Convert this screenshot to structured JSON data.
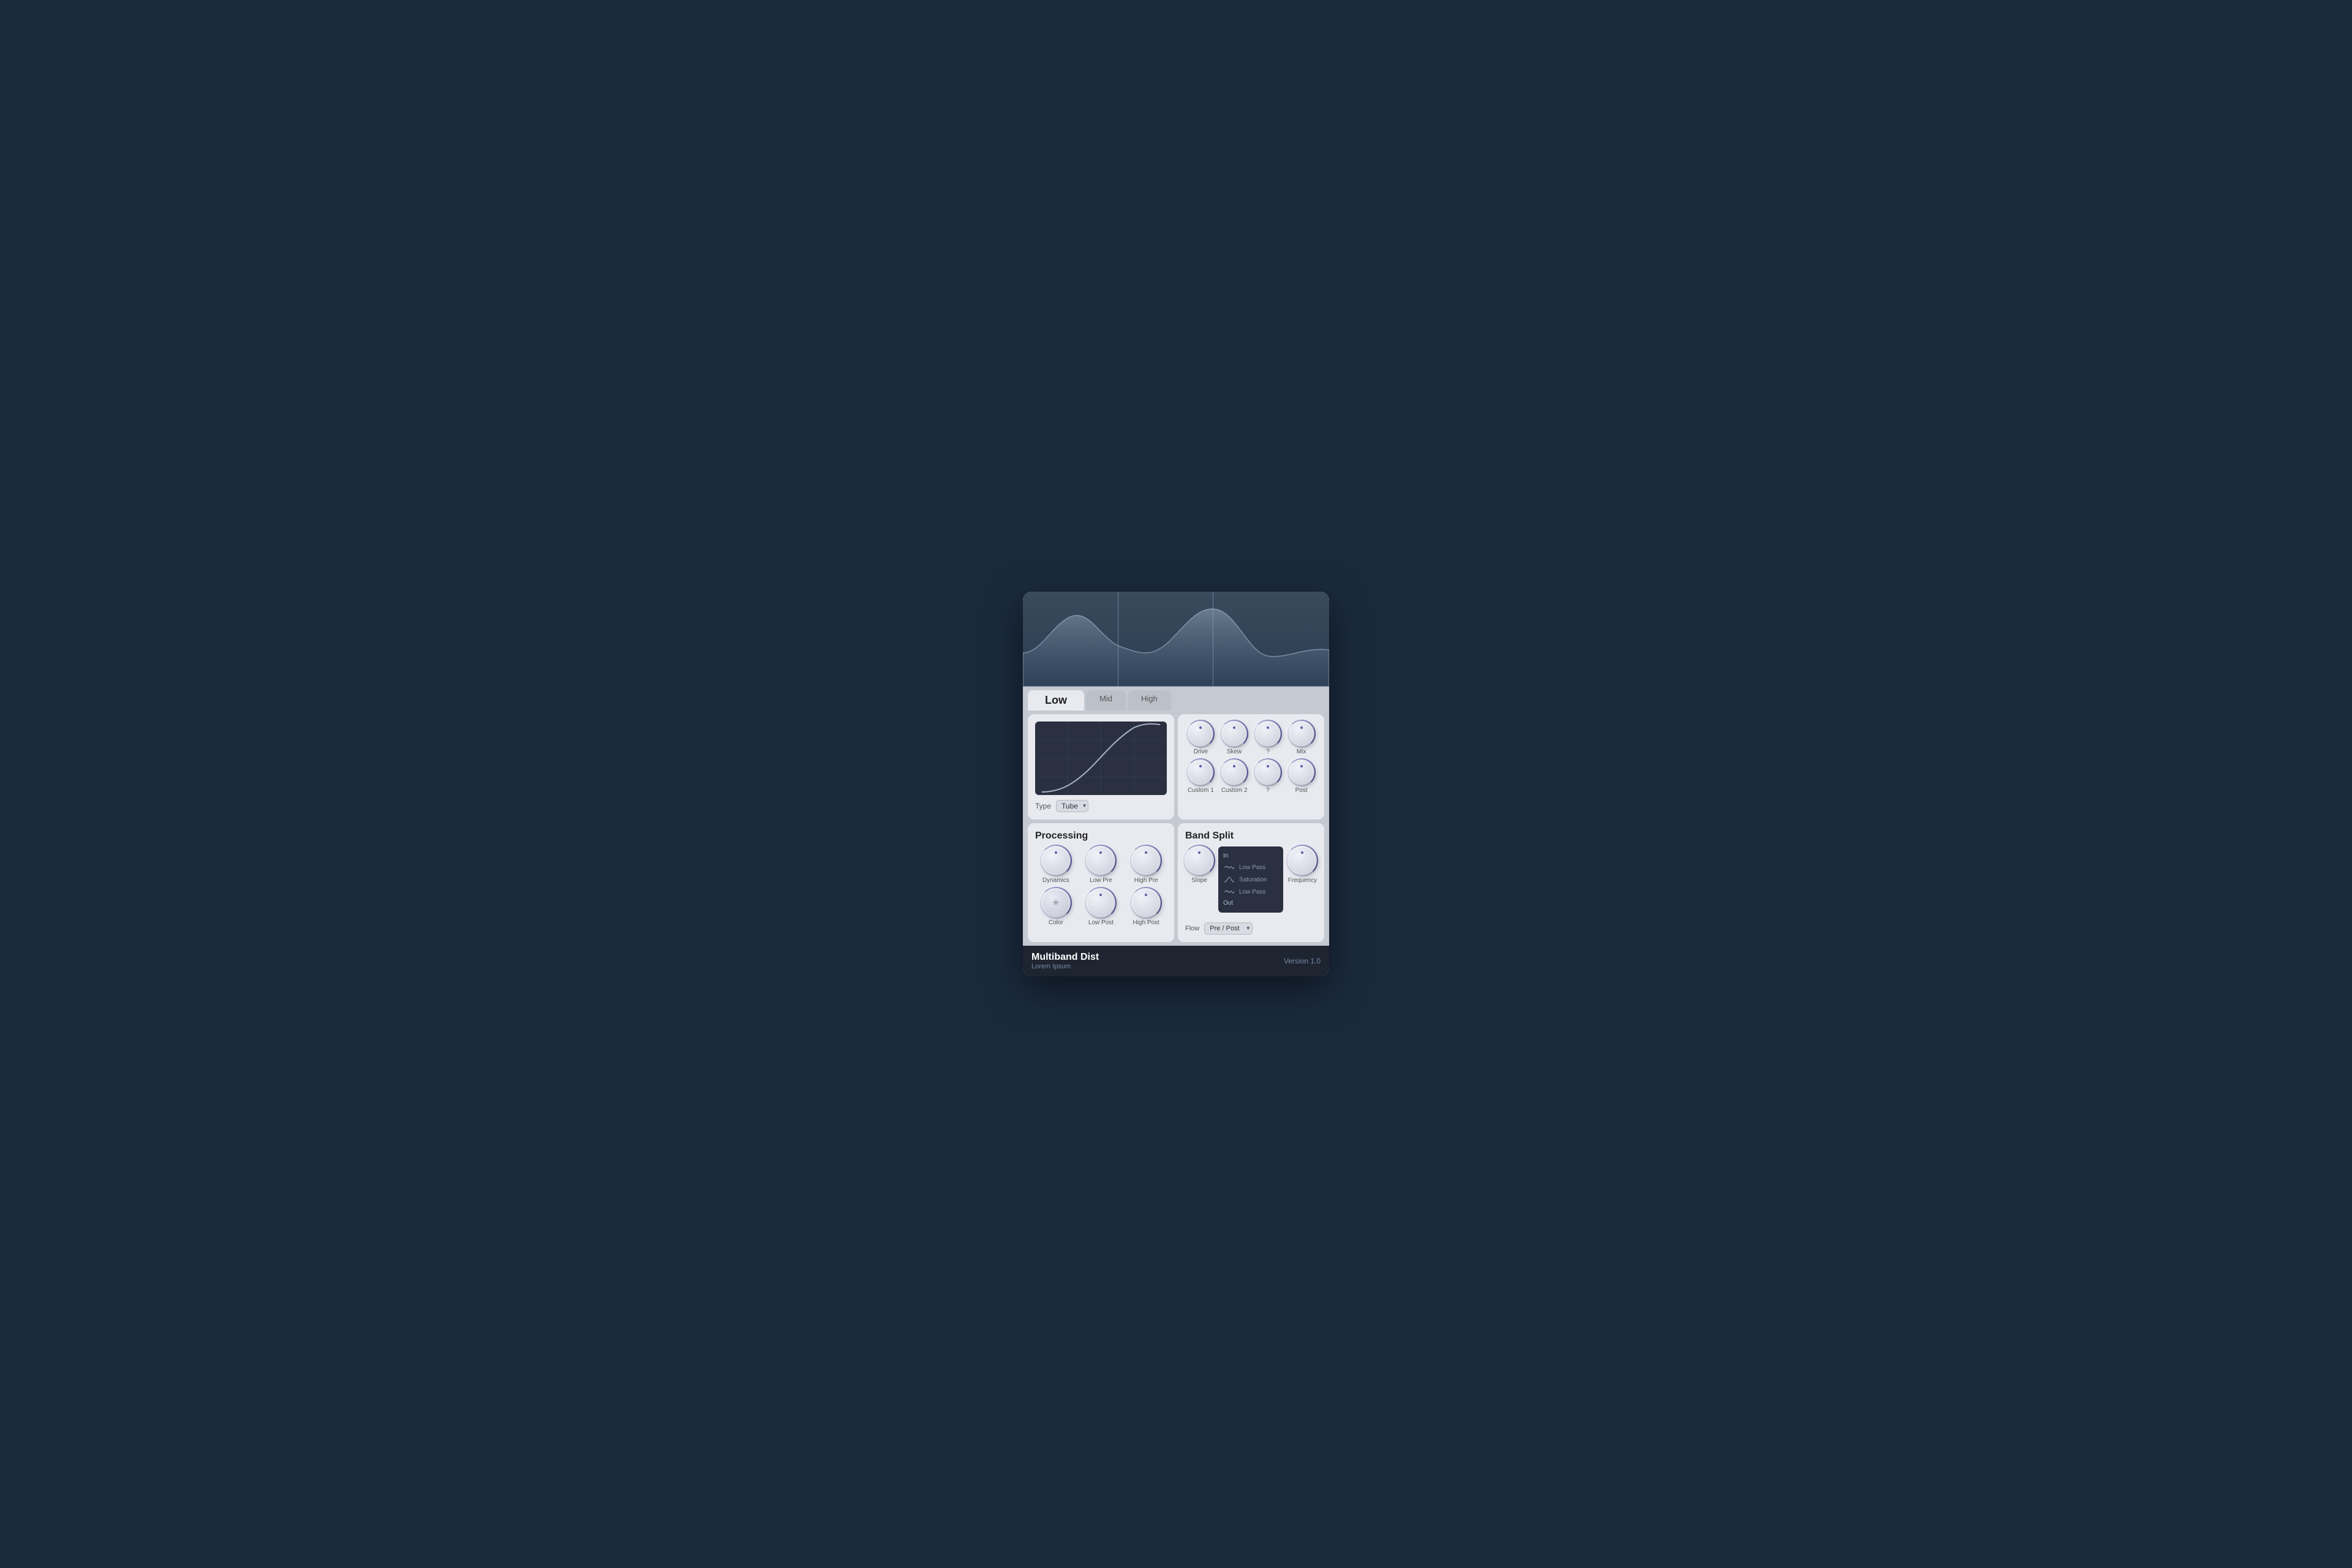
{
  "plugin": {
    "title": "Multiband Dist",
    "subtitle": "Lorem Ipsum",
    "version": "Version 1.0"
  },
  "tabs": [
    {
      "id": "low",
      "label": "Low",
      "active": true
    },
    {
      "id": "mid",
      "label": "Mid",
      "active": false
    },
    {
      "id": "high",
      "label": "High",
      "active": false
    }
  ],
  "low_panel": {
    "title": "Low",
    "type_label": "Type",
    "type_value": "Tube"
  },
  "mid_high_knobs": {
    "row1": [
      {
        "label": "Drive",
        "value": 0.5
      },
      {
        "label": "Skew",
        "value": 0.5
      },
      {
        "label": "?",
        "value": 0.5
      },
      {
        "label": "Mix",
        "value": 0.5
      }
    ],
    "row2": [
      {
        "label": "Custom 1",
        "value": 0.5
      },
      {
        "label": "Custom 2",
        "value": 0.5
      },
      {
        "label": "?",
        "value": 0.5
      },
      {
        "label": "Post",
        "value": 0.5
      }
    ]
  },
  "processing": {
    "title": "Processing",
    "knobs_row1": [
      {
        "label": "Dynamics",
        "value": 0.4
      },
      {
        "label": "Low Pre",
        "value": 0.5
      },
      {
        "label": "High Pre",
        "value": 0.5
      }
    ],
    "knobs_row2": [
      {
        "label": "Color",
        "value": 0.4,
        "is_color": true
      },
      {
        "label": "Low Post",
        "value": 0.5
      },
      {
        "label": "High Post",
        "value": 0.5
      }
    ]
  },
  "band_split": {
    "title": "Band Split",
    "slope_label": "Slope",
    "frequency_label": "Frequency",
    "diagram": {
      "in_label": "In",
      "out_label": "Out",
      "low_pass_label": "Low Pass",
      "saturation_label": "Saturation",
      "low_pass2_label": "Low Pass"
    },
    "flow_label": "Flow",
    "flow_value": "Pre / Post"
  }
}
